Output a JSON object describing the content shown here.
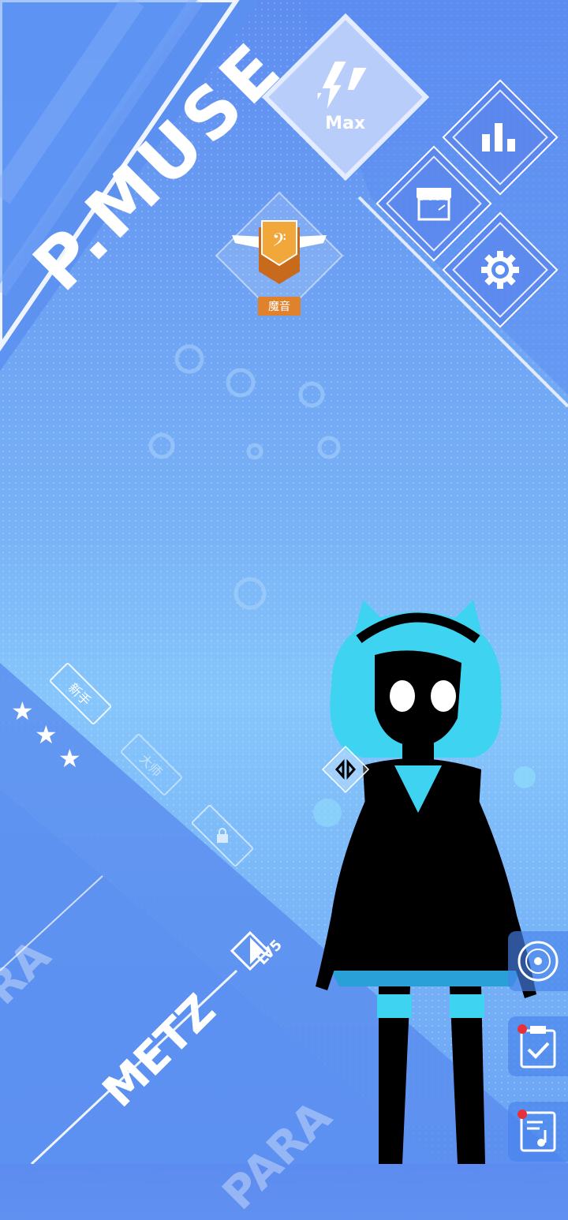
{
  "game": {
    "logo": "P.MUSE",
    "max_label": "Max",
    "rank_label": "魔音"
  },
  "difficulty": {
    "tags": [
      "新手",
      "大师"
    ],
    "stars_filled": 3
  },
  "song_cards": {
    "left_name": "RA",
    "main_name": "METZ",
    "bottom_name": "PARA",
    "level": "LV5"
  },
  "icons": {
    "menu": [
      "stats-icon",
      "shop-icon",
      "settings-icon"
    ],
    "side": [
      "disc-icon",
      "clipboard-check-icon",
      "music-sheet-icon"
    ]
  },
  "colors": {
    "accent": "#5d8cf0",
    "rank_orange": "#e0822d",
    "character_cyan": "#3fd3f2",
    "notification_red": "#e8303a"
  }
}
